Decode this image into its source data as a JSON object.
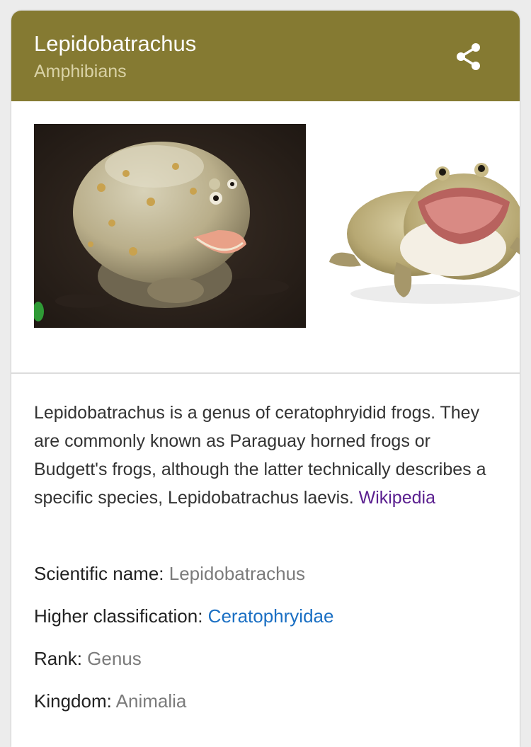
{
  "header": {
    "title": "Lepidobatrachus",
    "subtitle": "Amphibians",
    "share_icon": "share-icon",
    "color": "#857a32"
  },
  "images": [
    {
      "subject": "frog-on-dark-soil"
    },
    {
      "subject": "frog-on-white-background"
    }
  ],
  "description": {
    "text": "Lepidobatrachus is a genus of ceratophryidid frogs. They are commonly known as Paraguay horned frogs or Budgett's frogs, although the latter technically describes a specific species, Lepidobatrachus laevis. ",
    "source_link": "Wikipedia"
  },
  "facts": [
    {
      "label": "Scientific name:",
      "value": "Lepidobatrachus"
    },
    {
      "label": "Higher classification:",
      "value": "Ceratophryidae"
    },
    {
      "label": "Rank:",
      "value": "Genus"
    },
    {
      "label": "Kingdom:",
      "value": "Animalia"
    }
  ]
}
